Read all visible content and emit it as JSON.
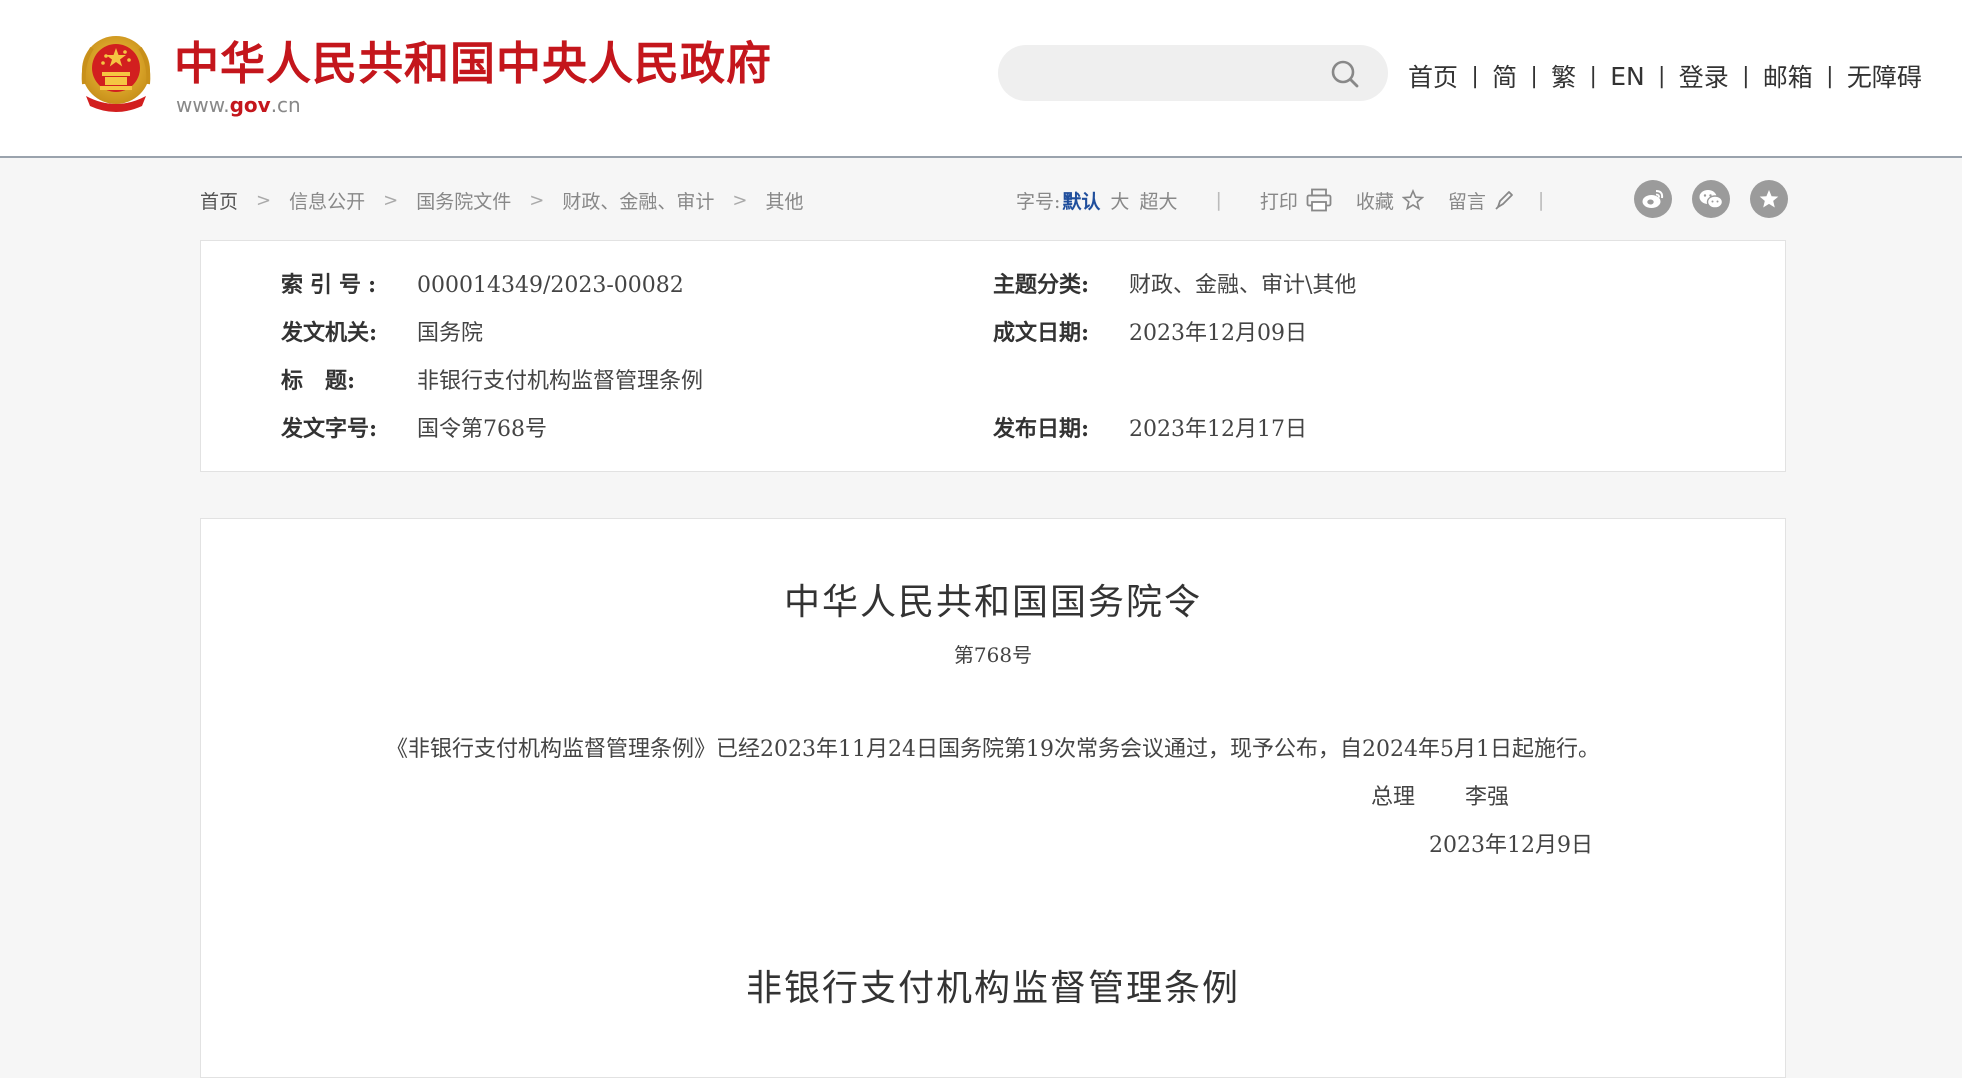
{
  "header": {
    "site_name": "中华人民共和国中央人民政府",
    "site_url_prefix": "www.",
    "site_url_mid": "gov",
    "site_url_suffix": ".cn",
    "search_placeholder": "",
    "brand_color": "#c4161c",
    "nav": [
      {
        "label": "首页"
      },
      {
        "label": "简"
      },
      {
        "label": "繁"
      },
      {
        "label": "EN"
      },
      {
        "label": "登录"
      },
      {
        "label": "邮箱"
      },
      {
        "label": "无障碍"
      }
    ],
    "nav_separator": "|"
  },
  "breadcrumb": {
    "items": [
      "首页",
      "信息公开",
      "国务院文件",
      "财政、金融、审计",
      "其他"
    ],
    "arrow": ">"
  },
  "tools": {
    "font_label": "字号:",
    "font_sizes": [
      "默认",
      "大",
      "超大"
    ],
    "active_font": "默认",
    "separator": "|",
    "print_label": "打印",
    "favorite_label": "收藏",
    "comment_label": "留言",
    "share_icons": [
      "weibo-icon",
      "wechat-icon",
      "star-icon"
    ]
  },
  "info": {
    "index_no": {
      "label": "索引号:",
      "value": "000014349/2023-00082"
    },
    "topic": {
      "label": "主题分类:",
      "value": "财政、金融、审计\\其他"
    },
    "issuer": {
      "label": "发文机关:",
      "value": "国务院"
    },
    "written_date": {
      "label": "成文日期:",
      "value": "2023年12月09日"
    },
    "title": {
      "label": "标　题:",
      "value": "非银行支付机构监督管理条例"
    },
    "doc_no": {
      "label": "发文字号:",
      "value": "国令第768号"
    },
    "publish_date": {
      "label": "发布日期:",
      "value": "2023年12月17日"
    }
  },
  "article": {
    "title": "中华人民共和国国务院令",
    "number": "第768号",
    "body": "《非银行支付机构监督管理条例》已经2023年11月24日国务院第19次常务会议通过，现予公布，自2024年5月1日起施行。",
    "signer_title": "总理",
    "signer_name": "李强",
    "sign_date": "2023年12月9日",
    "regulation_title": "非银行支付机构监督管理条例"
  }
}
